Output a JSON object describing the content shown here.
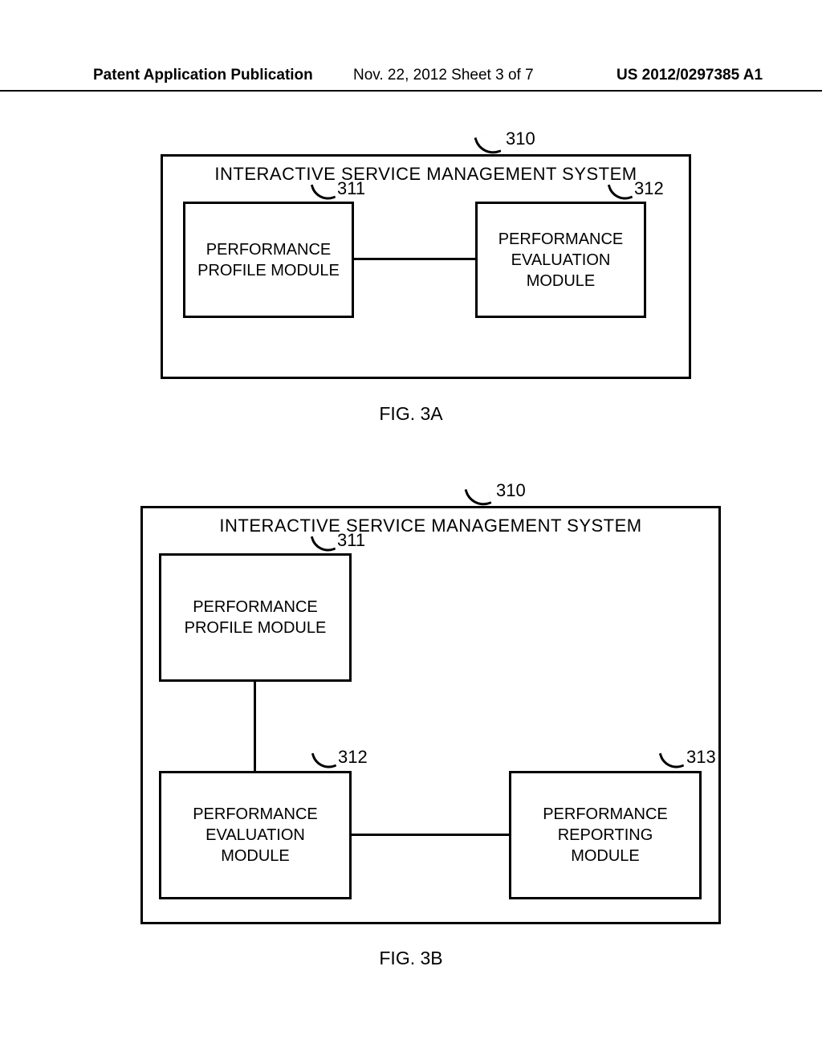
{
  "header": {
    "left": "Patent Application Publication",
    "mid": "Nov. 22, 2012  Sheet 3 of 7",
    "right": "US 2012/0297385 A1"
  },
  "fig3a": {
    "ref_outer": "310",
    "title": "INTERACTIVE SERVICE MANAGEMENT SYSTEM",
    "ref_box1": "311",
    "box1": "PERFORMANCE\nPROFILE MODULE",
    "ref_box2": "312",
    "box2": "PERFORMANCE\nEVALUATION\nMODULE",
    "caption": "FIG. 3A"
  },
  "fig3b": {
    "ref_outer": "310",
    "title": "INTERACTIVE SERVICE MANAGEMENT SYSTEM",
    "ref_box1": "311",
    "box1": "PERFORMANCE\nPROFILE MODULE",
    "ref_box2": "312",
    "box2": "PERFORMANCE\nEVALUATION\nMODULE",
    "ref_box3": "313",
    "box3": "PERFORMANCE\nREPORTING\nMODULE",
    "caption": "FIG. 3B"
  }
}
